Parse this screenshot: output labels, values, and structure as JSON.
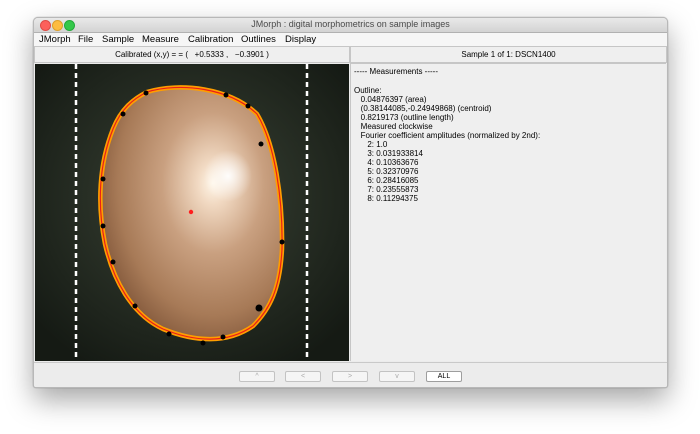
{
  "window": {
    "title": "JMorph : digital morphometrics on sample images"
  },
  "menu": {
    "items": [
      "JMorph",
      "File",
      "Sample",
      "Measure",
      "Calibration",
      "Outlines",
      "Display"
    ]
  },
  "coords_label": "Calibrated (x,y) = = (   +0.5333 ,   −0.3901 )",
  "sample_label": "Sample 1 of 1: DSCN1400",
  "measurements": {
    "header": "----- Measurements -----",
    "lines": [
      "Outline:",
      "   0.04876397 (area)",
      "   (0.38144085,-0.24949868) (centroid)",
      "   0.8219173 (outline length)",
      "   Measured clockwise",
      "   Fourier coefficient amplitudes (normalized by 2nd):",
      "      2: 1.0",
      "      3: 0.031933814",
      "      4: 0.10363676",
      "      5: 0.32370976",
      "      6: 0.28416085",
      "      7: 0.23555873",
      "      8: 0.11294375"
    ]
  },
  "nav": {
    "up": "^",
    "left": "<",
    "right": ">",
    "down": "v",
    "all": "ALL"
  },
  "colors": {
    "outline_outer": "#ff9e00",
    "outline_inner": "#e8201a",
    "centroid": "#ff1e1e",
    "landmark": "#000000"
  }
}
